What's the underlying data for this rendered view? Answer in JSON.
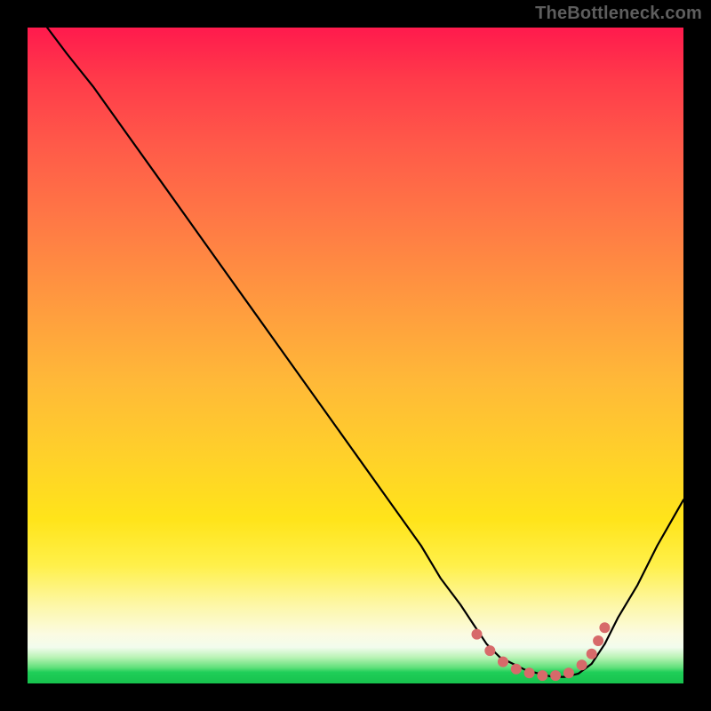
{
  "watermark": "TheBottleneck.com",
  "colors": {
    "frame_background": "#000000",
    "curve_stroke": "#000000",
    "dot_fill": "#d76a6a",
    "gradient_stops": [
      "#ff1a4d",
      "#ff7a45",
      "#ffd229",
      "#fbfbe2",
      "#17c24d"
    ]
  },
  "chart_data": {
    "type": "line",
    "title": "",
    "xlabel": "",
    "ylabel": "",
    "xlim": [
      0,
      100
    ],
    "ylim": [
      0,
      100
    ],
    "grid": false,
    "legend": false,
    "series": [
      {
        "name": "bottleneck-curve",
        "x": [
          3,
          6,
          10,
          15,
          20,
          25,
          30,
          35,
          40,
          45,
          50,
          55,
          60,
          63,
          66,
          68,
          70,
          72,
          74,
          76,
          78,
          80,
          82,
          84,
          86,
          88,
          90,
          93,
          96,
          100
        ],
        "y": [
          100,
          96,
          91,
          84,
          77,
          70,
          63,
          56,
          49,
          42,
          35,
          28,
          21,
          16,
          12,
          9,
          6,
          4,
          3,
          2,
          1.5,
          1,
          1,
          1.5,
          3,
          6,
          10,
          15,
          21,
          28
        ]
      }
    ],
    "markers": [
      {
        "name": "valley-dot",
        "x": 68.5,
        "y": 7.5
      },
      {
        "name": "valley-dot",
        "x": 70.5,
        "y": 5.0
      },
      {
        "name": "valley-dot",
        "x": 72.5,
        "y": 3.3
      },
      {
        "name": "valley-dot",
        "x": 74.5,
        "y": 2.2
      },
      {
        "name": "valley-dot",
        "x": 76.5,
        "y": 1.6
      },
      {
        "name": "valley-dot",
        "x": 78.5,
        "y": 1.2
      },
      {
        "name": "valley-dot",
        "x": 80.5,
        "y": 1.2
      },
      {
        "name": "valley-dot",
        "x": 82.5,
        "y": 1.6
      },
      {
        "name": "valley-dot",
        "x": 84.5,
        "y": 2.8
      },
      {
        "name": "valley-dot",
        "x": 86.0,
        "y": 4.5
      },
      {
        "name": "valley-dot",
        "x": 87.0,
        "y": 6.5
      },
      {
        "name": "valley-dot",
        "x": 88.0,
        "y": 8.5
      }
    ]
  }
}
